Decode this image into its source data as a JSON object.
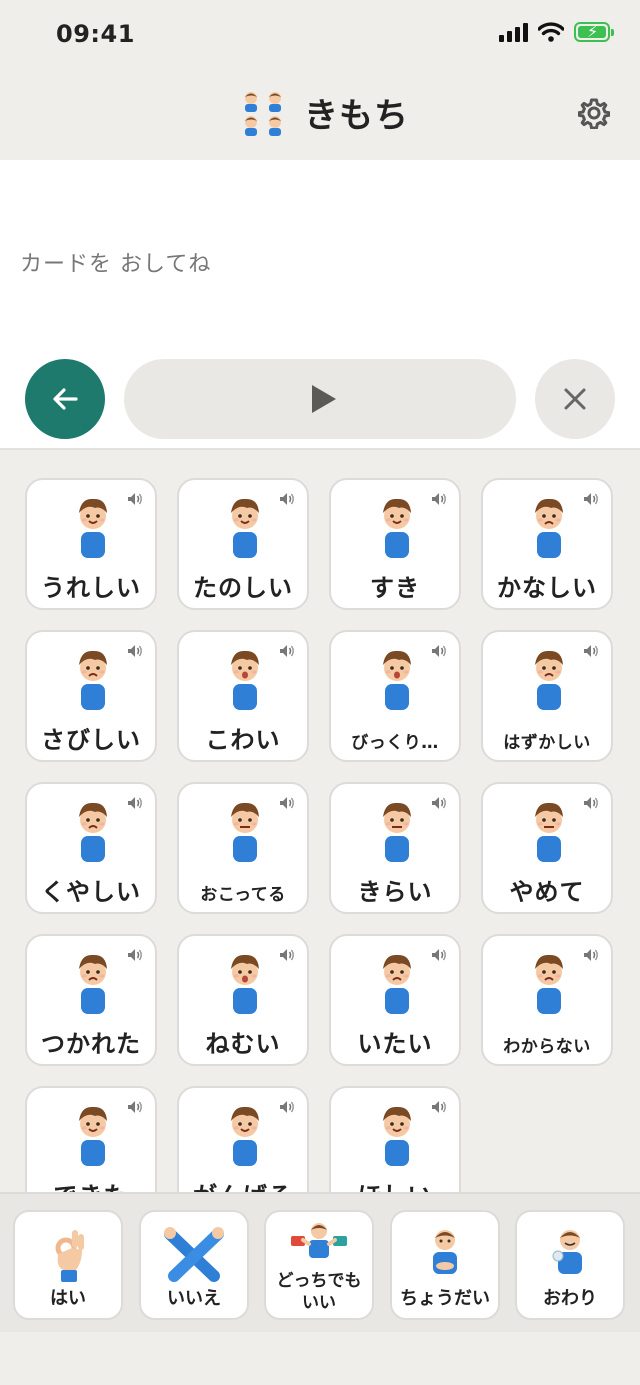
{
  "status": {
    "time": "09:41"
  },
  "header": {
    "title": "きもち"
  },
  "message": {
    "placeholder": "カードを おしてね"
  },
  "cards": [
    {
      "label": "うれしい"
    },
    {
      "label": "たのしい"
    },
    {
      "label": "すき"
    },
    {
      "label": "かなしい"
    },
    {
      "label": "さびしい"
    },
    {
      "label": "こわい"
    },
    {
      "label": "びっくり…"
    },
    {
      "label": "はずかしい"
    },
    {
      "label": "くやしい"
    },
    {
      "label": "おこってる"
    },
    {
      "label": "きらい"
    },
    {
      "label": "やめて"
    },
    {
      "label": "つかれた"
    },
    {
      "label": "ねむい"
    },
    {
      "label": "いたい"
    },
    {
      "label": "わからない"
    },
    {
      "label": "できた"
    },
    {
      "label": "がんばる"
    },
    {
      "label": "ほしい"
    }
  ],
  "quick_replies": [
    {
      "label": "はい",
      "icon": "ok-hand-icon"
    },
    {
      "label": "いいえ",
      "icon": "crossed-arms-icon"
    },
    {
      "label": "どっちでも",
      "label2": "いい",
      "icon": "either-is-fine-icon"
    },
    {
      "label": "ちょうだい",
      "icon": "give-me-icon"
    },
    {
      "label": "おわり",
      "icon": "finished-icon"
    }
  ],
  "colors": {
    "accent": "#1e7a6d",
    "shirt": "#2f7fd6",
    "hair": "#7a4a24",
    "skin": "#f4c9a3",
    "battery": "#3dbf52"
  }
}
